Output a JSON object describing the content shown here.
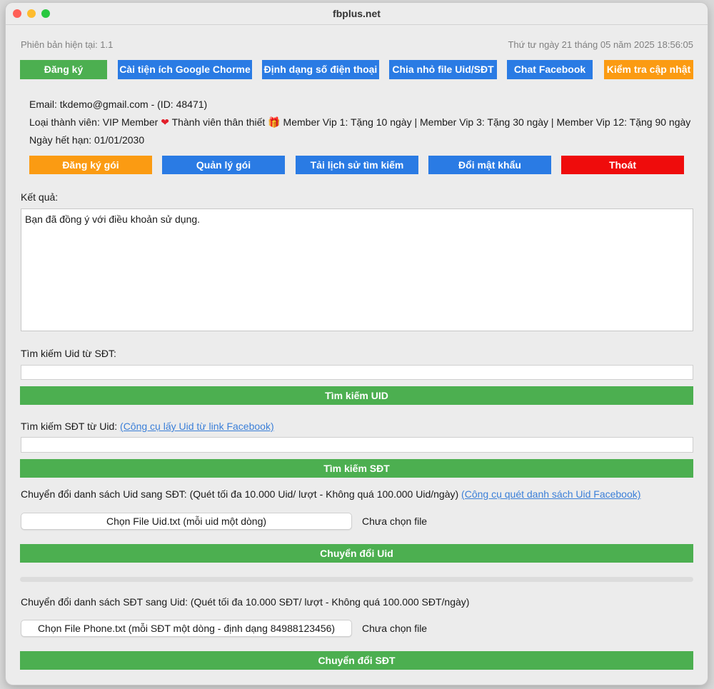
{
  "window": {
    "title": "fbplus.net"
  },
  "header": {
    "version": "Phiên bản hiện tại: 1.1",
    "datetime": "Thứ tư ngày 21 tháng 05 năm 2025 18:56:05"
  },
  "toolbar": {
    "register": "Đăng ký",
    "install_extension": "Cài tiện ích Google Chorme",
    "phone_format": "Định dạng số điện thoại",
    "split_file": "Chia nhỏ file Uid/SĐT",
    "chat_facebook": "Chat Facebook",
    "check_update": "Kiểm tra cập nhật"
  },
  "account": {
    "email_line": "Email: tkdemo@gmail.com - (ID: 48471)",
    "member_prefix": "Loại thành viên: VIP Member",
    "member_loyal": "Thành viên thân thiết",
    "member_offers": "Member Vip 1: Tặng 10 ngày | Member Vip 3: Tặng 30 ngày | Member Vip 12: Tặng 90 ngày",
    "expiry": "Ngày hết hạn: 01/01/2030"
  },
  "account_actions": {
    "subscribe": "Đăng ký gói",
    "manage": "Quản lý gói",
    "download_history": "Tải lịch sử tìm kiếm",
    "change_password": "Đổi mật khẩu",
    "logout": "Thoát"
  },
  "result": {
    "label": "Kết quả:",
    "text": "Bạn đã đồng ý với điều khoản sử dụng."
  },
  "uid_search": {
    "label": "Tìm kiếm Uid từ SĐT:",
    "value": "",
    "button": "Tìm kiếm UID"
  },
  "phone_search": {
    "label": "Tìm kiếm SĐT từ Uid:",
    "link": "(Công cụ lấy Uid từ link Facebook)",
    "value": "",
    "button": "Tìm kiếm SĐT"
  },
  "uid_convert": {
    "label": "Chuyển đổi danh sách Uid sang SĐT: (Quét tối đa 10.000 Uid/ lượt - Không quá 100.000 Uid/ngày)",
    "link": "(Công cụ quét danh sách Uid Facebook)",
    "file_button": "Chọn File Uid.txt (mỗi uid một dòng)",
    "file_status": "Chưa chọn file",
    "button": "Chuyển đổi Uid",
    "progress": 0
  },
  "phone_convert": {
    "label": "Chuyển đổi danh sách SĐT sang Uid: (Quét tối đa 10.000 SĐT/ lượt - Không quá 100.000 SĐT/ngày)",
    "file_button": "Chọn File Phone.txt (mỗi SĐT một dòng - định dạng 84988123456)",
    "file_status": "Chưa chọn file",
    "button": "Chuyển đổi SĐT"
  },
  "colors": {
    "green": "#4caf50",
    "blue": "#2a7be4",
    "orange": "#fb9b12",
    "red": "#ef0c0c"
  }
}
